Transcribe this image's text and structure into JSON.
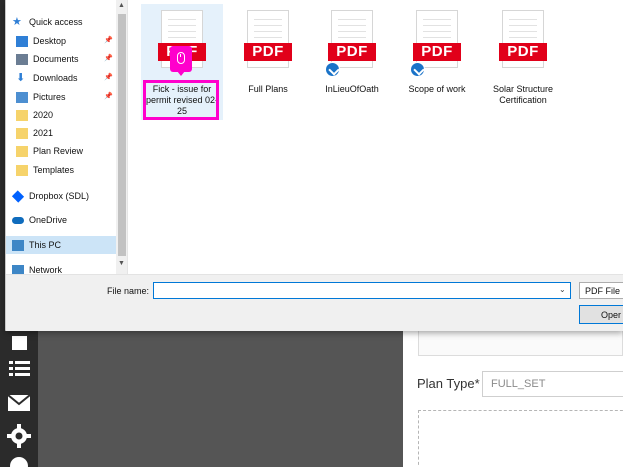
{
  "dialog": {
    "nav": {
      "items": [
        {
          "label": "Quick access",
          "icon": "star-icon",
          "pinned": false
        },
        {
          "label": "Desktop",
          "icon": "desktop-icon",
          "pinned": true
        },
        {
          "label": "Documents",
          "icon": "documents-icon",
          "pinned": true
        },
        {
          "label": "Downloads",
          "icon": "download-icon",
          "pinned": true
        },
        {
          "label": "Pictures",
          "icon": "pictures-icon",
          "pinned": true
        },
        {
          "label": "2020",
          "icon": "folder-icon",
          "pinned": false
        },
        {
          "label": "2021",
          "icon": "folder-icon",
          "pinned": false
        },
        {
          "label": "Plan Review",
          "icon": "folder-icon",
          "pinned": false
        },
        {
          "label": "Templates",
          "icon": "folder-icon",
          "pinned": false
        },
        {
          "label": "Dropbox (SDL)",
          "icon": "dropbox-icon",
          "pinned": false
        },
        {
          "label": "OneDrive",
          "icon": "onedrive-icon",
          "pinned": false
        },
        {
          "label": "This PC",
          "icon": "computer-icon",
          "pinned": false,
          "selected": true
        },
        {
          "label": "Network",
          "icon": "network-icon",
          "pinned": false
        }
      ]
    },
    "files": [
      {
        "name": "Fick - issue for permit revised 02-25",
        "icon_text": "PDF",
        "synced": false,
        "selected": true
      },
      {
        "name": "Full Plans",
        "icon_text": "PDF",
        "synced": false
      },
      {
        "name": "InLieuOfOath",
        "icon_text": "PDF",
        "synced": true
      },
      {
        "name": "Scope of work",
        "icon_text": "PDF",
        "synced": true
      },
      {
        "name": "Solar Structure Certification",
        "icon_text": "PDF",
        "synced": false
      }
    ],
    "bottom": {
      "file_name_label": "File name:",
      "file_name_value": "",
      "file_type": "PDF File",
      "open_label": "Oper"
    }
  },
  "background": {
    "plan_type_label": "Plan Type*",
    "plan_type_value": "FULL_SET"
  },
  "colors": {
    "pdf_red": "#e1001a",
    "highlight": "#ff00cc",
    "selection": "#cce4f7",
    "accent": "#0078d7",
    "sync_badge": "#1a73c8"
  }
}
